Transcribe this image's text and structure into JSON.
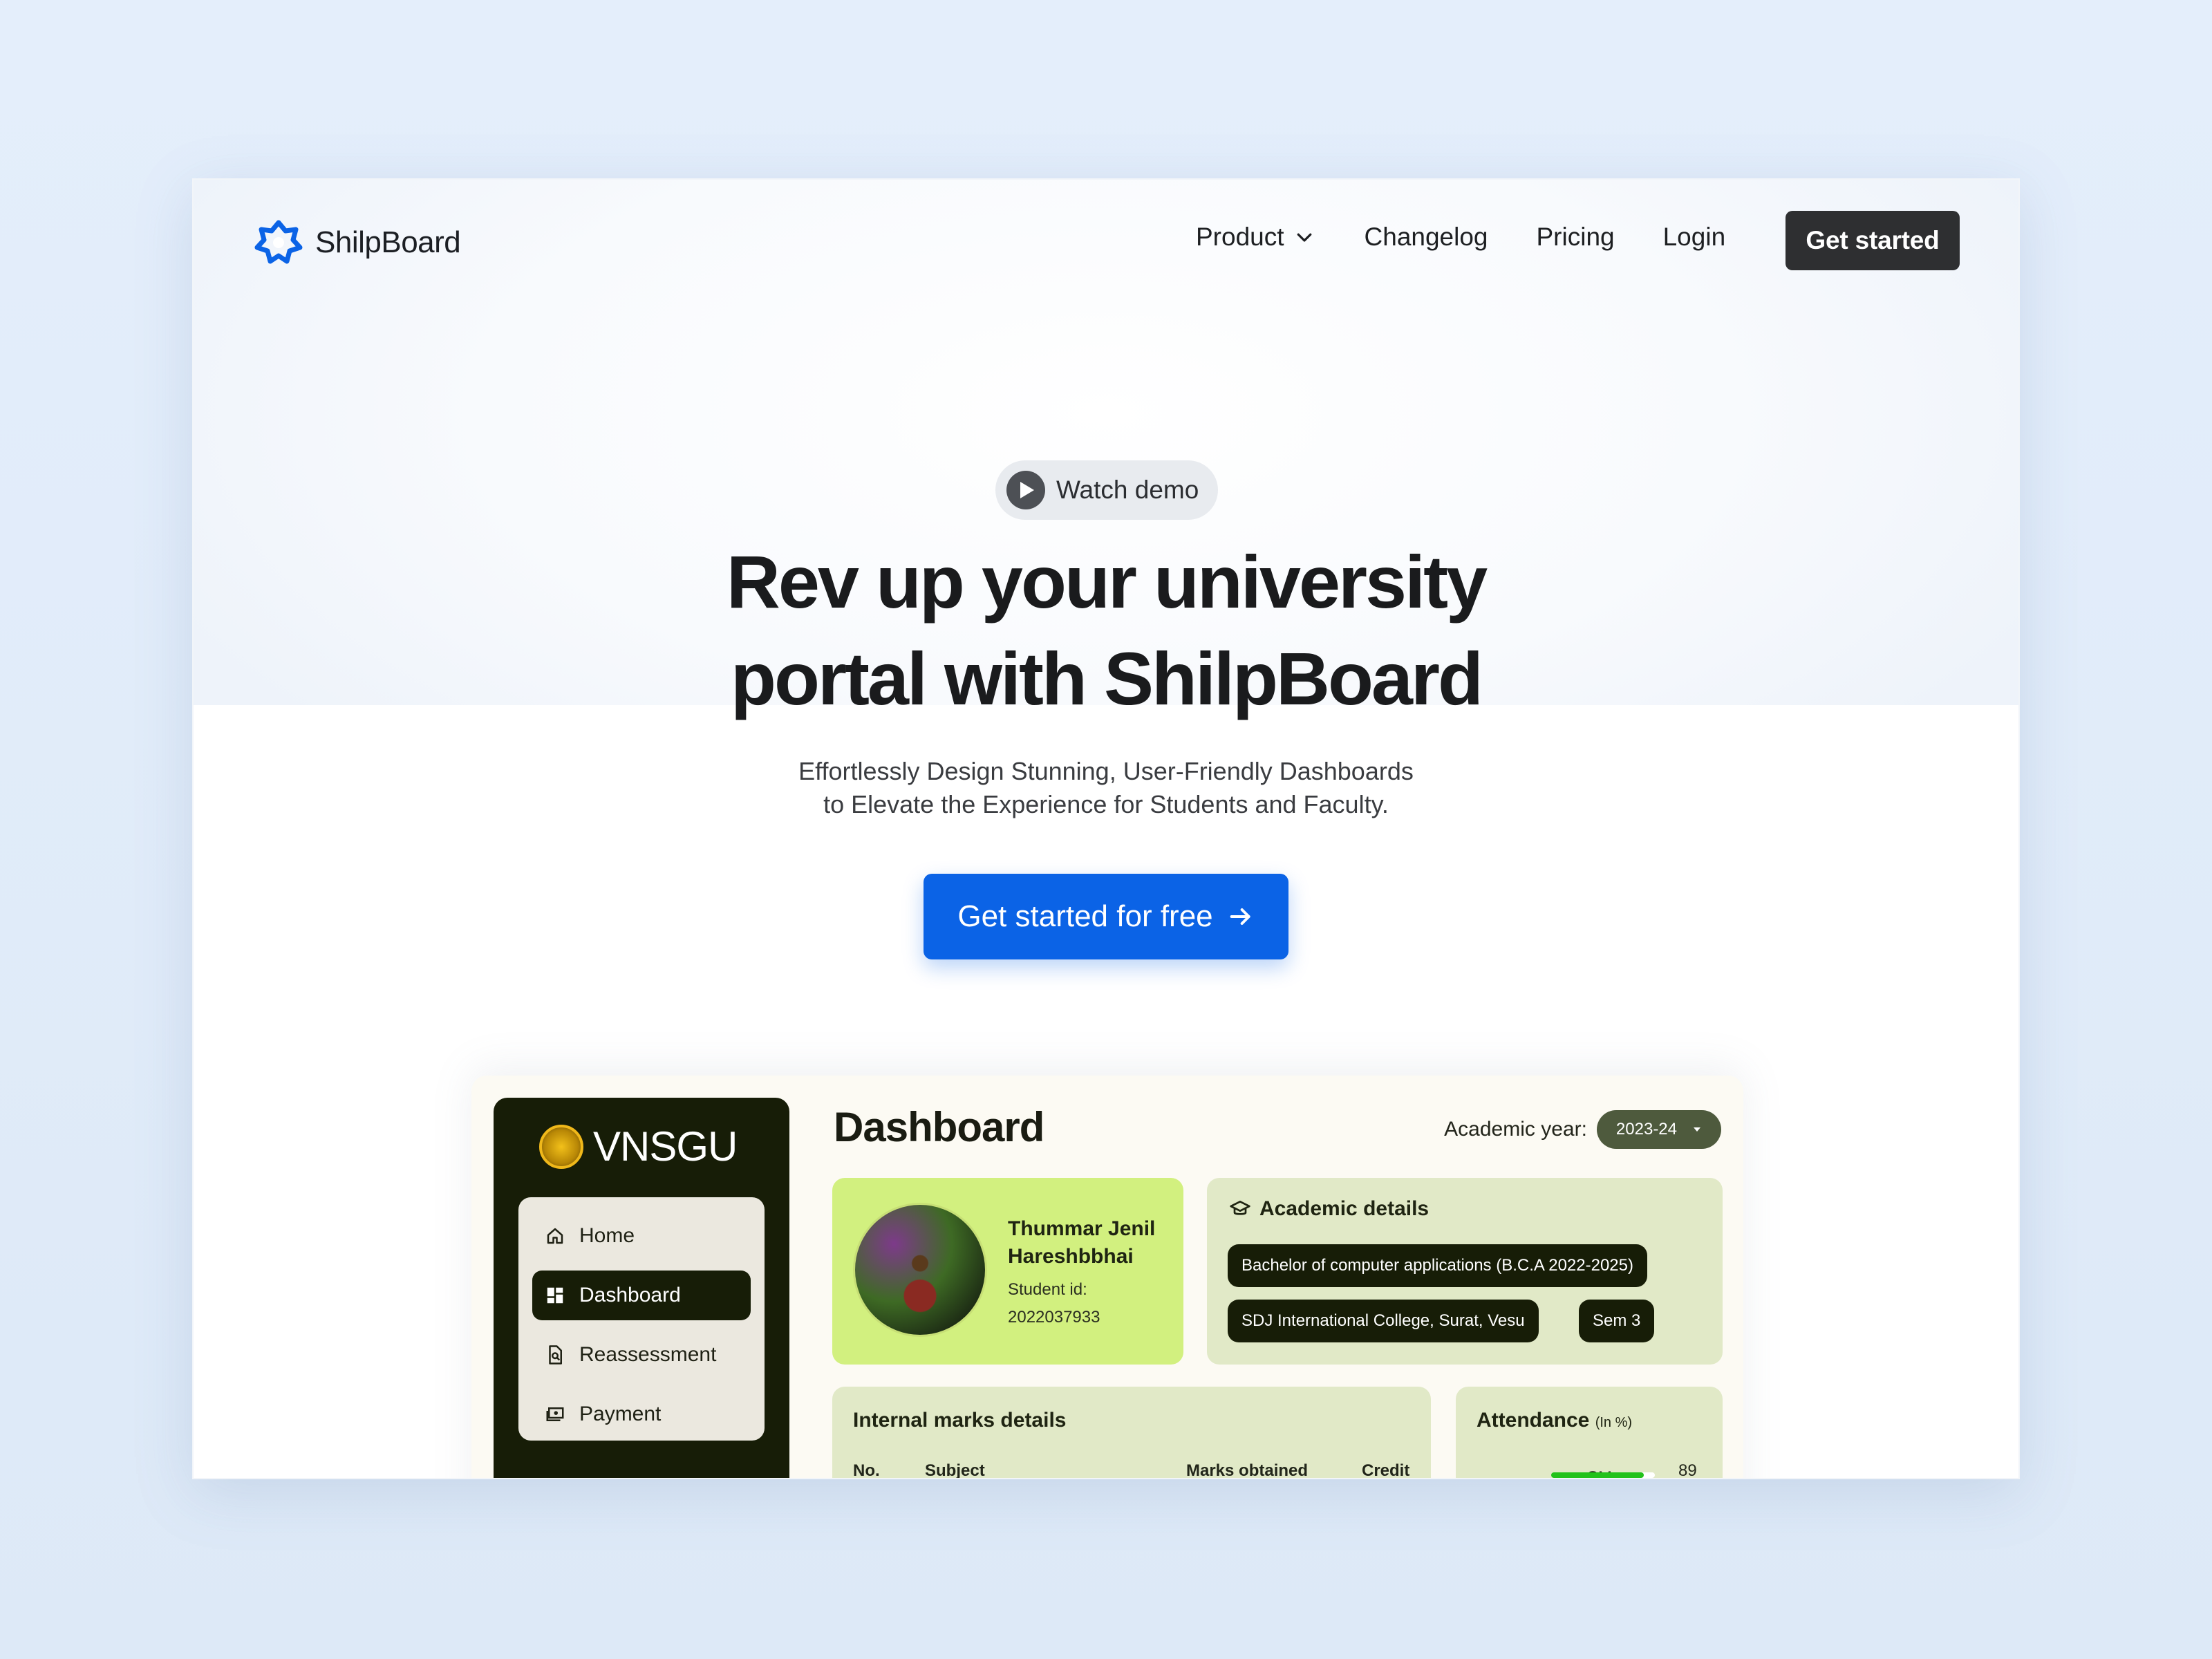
{
  "nav": {
    "logo_text": "ShilpBoard",
    "items": [
      {
        "label": "Product"
      },
      {
        "label": "Changelog"
      },
      {
        "label": "Pricing"
      },
      {
        "label": "Login"
      }
    ],
    "cta": "Get started"
  },
  "hero": {
    "pill": "Watch demo",
    "title_line1": "Rev up your university",
    "title_line2": "portal with ShilpBoard",
    "subtitle_line1": "Effortlessly Design Stunning, User-Friendly Dashboards",
    "subtitle_line2": "to Elevate the Experience for Students and Faculty.",
    "cta": "Get started for free"
  },
  "dashboard": {
    "brand": "VNSGU",
    "menu": [
      {
        "label": "Home",
        "icon": "home-icon"
      },
      {
        "label": "Dashboard",
        "icon": "dashboard-icon"
      },
      {
        "label": "Reassessment",
        "icon": "document-search-icon"
      },
      {
        "label": "Payment",
        "icon": "payment-icon"
      }
    ],
    "title": "Dashboard",
    "academic_year_label": "Academic year:",
    "academic_year_value": "2023-24",
    "profile": {
      "name_line1": "Thummar Jenil",
      "name_line2": "Hareshbbhai",
      "id_label": "Student id:",
      "id_value": "2022037933"
    },
    "academic": {
      "title": "Academic details",
      "course": "Bachelor of computer applications (B.C.A 2022-2025)",
      "college": "SDJ International College, Surat, Vesu",
      "semester": "Sem 3"
    },
    "marks": {
      "title": "Internal marks details",
      "columns": [
        "No.",
        "Subject",
        "Marks obtained",
        "Credit"
      ]
    },
    "attendance": {
      "title": "Attendance",
      "unit": "(In %)",
      "rows": [
        {
          "subject": "SM",
          "value": "89",
          "percent": 89
        }
      ]
    }
  },
  "colors": {
    "primary": "#0b63e6",
    "dark_button": "#2e2f31",
    "sidebar": "#171d07",
    "profile_card": "#d2f07f",
    "card": "#e1e9c7",
    "progress": "#22c21a"
  }
}
